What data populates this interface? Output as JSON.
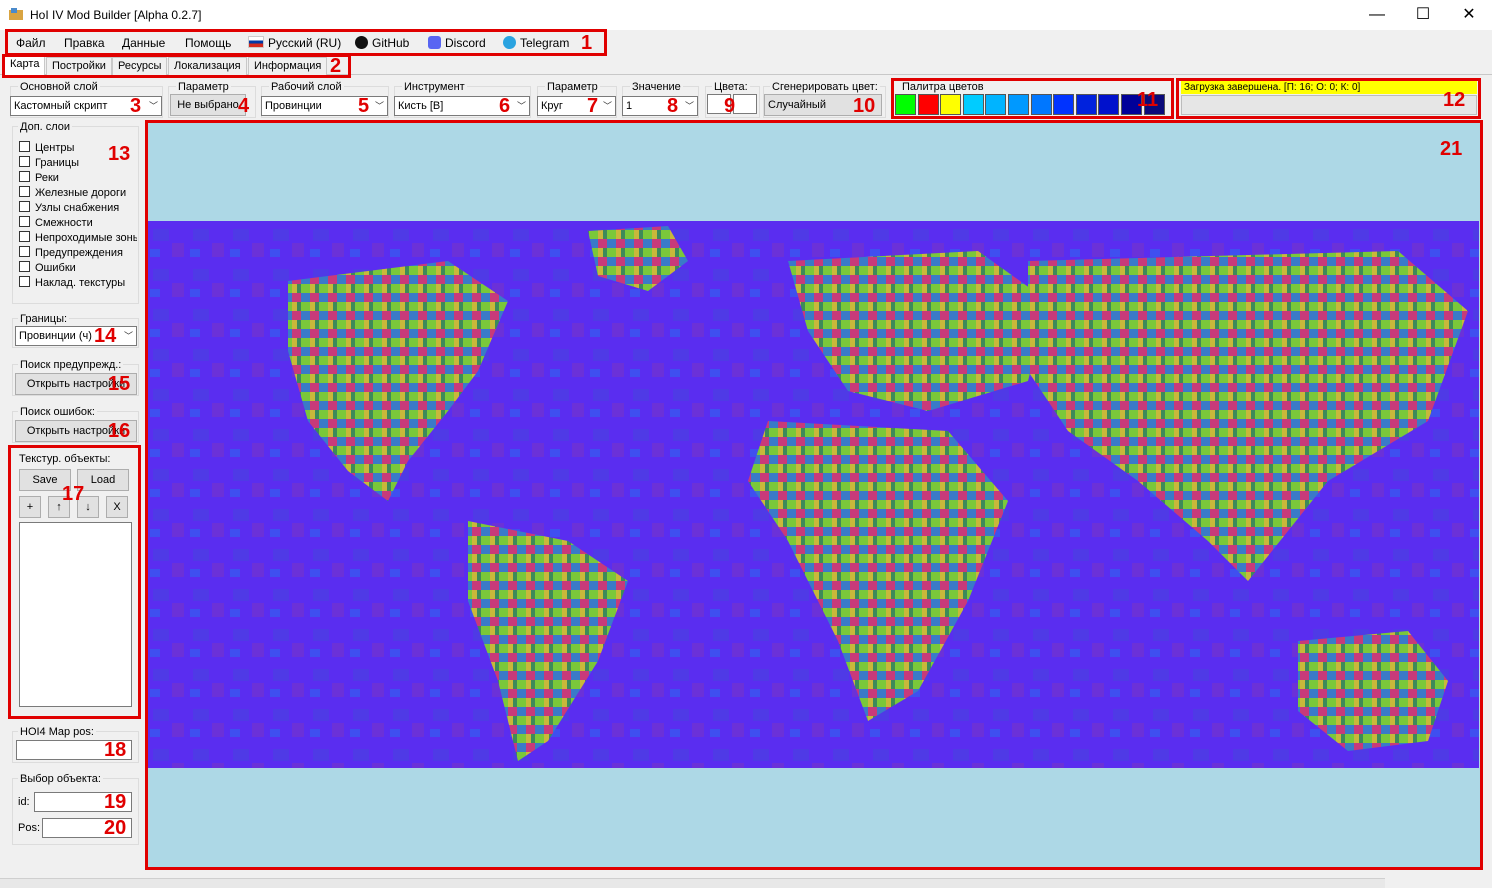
{
  "window": {
    "title": "HoI IV Mod Builder [Alpha 0.2.7]",
    "min": "—",
    "max": "☐",
    "close": "✕"
  },
  "menu": {
    "file": "Файл",
    "edit": "Правка",
    "data": "Данные",
    "help": "Помощь",
    "language": "Русский (RU)",
    "github": "GitHub",
    "discord": "Discord",
    "telegram": "Telegram"
  },
  "tabs": [
    "Карта",
    "Постройки",
    "Ресурсы",
    "Локализация",
    "Информация"
  ],
  "toolbar": {
    "main_layer": {
      "label": "Основной слой",
      "value": "Кастомный скрипт"
    },
    "parameter": {
      "label": "Параметр",
      "value": "Не выбрано"
    },
    "working_layer": {
      "label": "Рабочий слой",
      "value": "Провинции"
    },
    "tool": {
      "label": "Инструмент",
      "value": "Кисть [B]"
    },
    "brush_param": {
      "label": "Параметр",
      "value": "Круг"
    },
    "value": {
      "label": "Значение",
      "value": "1"
    },
    "colors": {
      "label": "Цвета:"
    },
    "gen_color": {
      "label": "Сгенерировать цвет:",
      "value": "Случайный"
    },
    "palette": {
      "label": "Палитра цветов",
      "colors": [
        "#00ff00",
        "#ff0000",
        "#ffff00",
        "#00ccff",
        "#00b4ff",
        "#0099ff",
        "#0077ff",
        "#0033ff",
        "#0022dd",
        "#0011cc",
        "#000099",
        "#0a0a7a"
      ]
    },
    "status": "Загрузка завершена. [П: 16; О: 0; К: 0]"
  },
  "sidebar": {
    "extra_layers": {
      "label": "Доп. слои",
      "items": [
        "Центры",
        "Границы",
        "Реки",
        "Железные дороги",
        "Узлы снабжения",
        "Смежности",
        "Непроходимые зоны",
        "Предупреждения",
        "Ошибки",
        "Наклад. текстуры"
      ]
    },
    "borders": {
      "label": "Границы:",
      "value": "Провинции (ч)"
    },
    "warnings": {
      "label": "Поиск предупрежд.:",
      "button": "Открыть настройки"
    },
    "errors": {
      "label": "Поиск ошибок:",
      "button": "Открыть настройки"
    },
    "textured": {
      "label": "Текстур. объекты:",
      "save": "Save",
      "load": "Load",
      "add": "+",
      "up": "↑",
      "down": "↓",
      "remove": "X"
    },
    "map_pos": {
      "label": "HOI4 Map pos:"
    },
    "object": {
      "label": "Выбор объекта:",
      "id_label": "id:",
      "pos_label": "Pos:"
    }
  },
  "annotations": [
    "1",
    "2",
    "3",
    "4",
    "5",
    "6",
    "7",
    "8",
    "9",
    "10",
    "11",
    "12",
    "13",
    "14",
    "15",
    "16",
    "17",
    "18",
    "19",
    "20",
    "21"
  ],
  "colors": {
    "annotation": "#e00000",
    "map_sea": "#add8e6",
    "ocean": "#5a2df0",
    "status_bg": "#ffff00"
  }
}
